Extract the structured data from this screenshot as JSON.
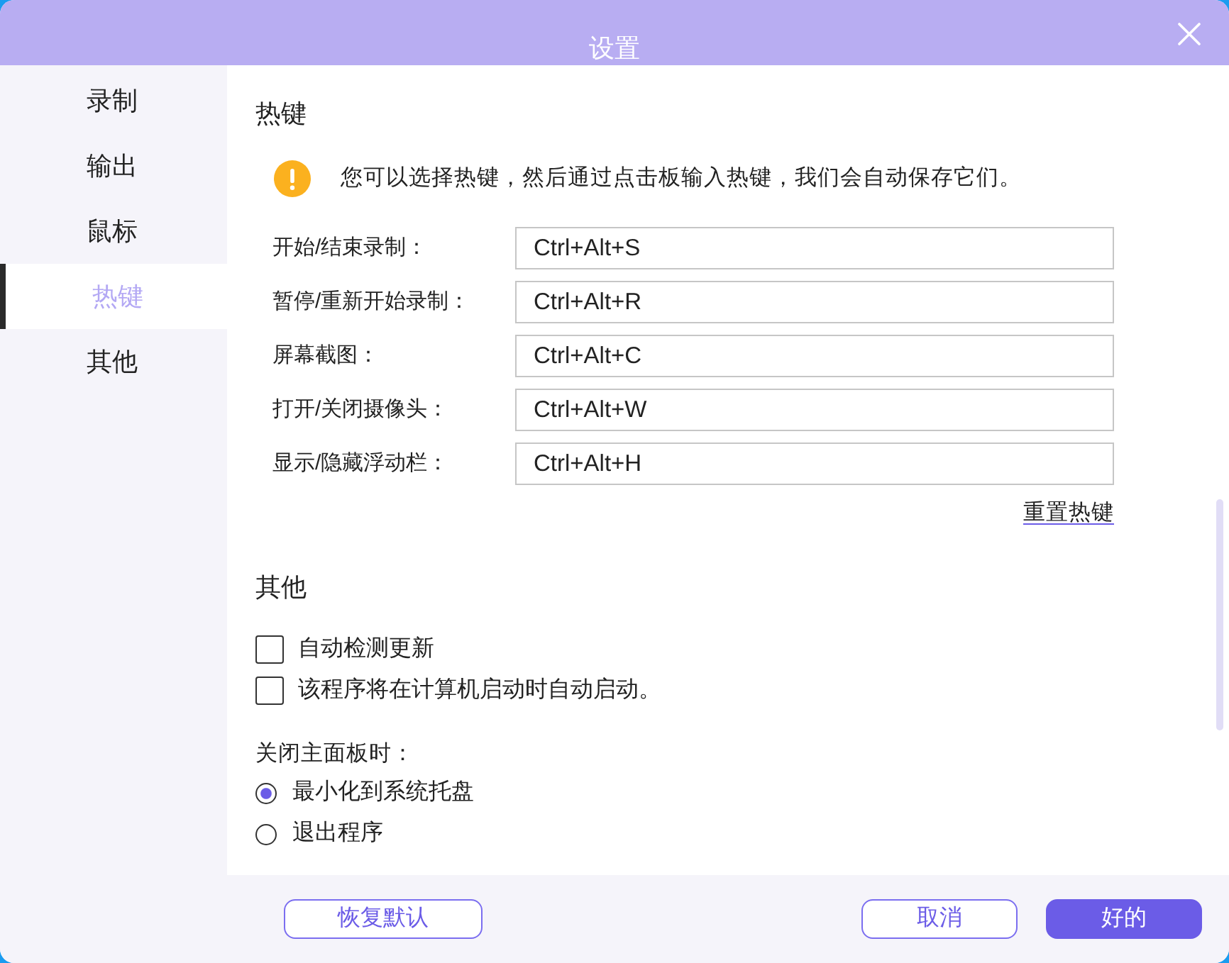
{
  "window": {
    "title": "设置"
  },
  "sidebar": {
    "items": [
      {
        "label": "录制",
        "selected": false
      },
      {
        "label": "输出",
        "selected": false
      },
      {
        "label": "鼠标",
        "selected": false
      },
      {
        "label": "热键",
        "selected": true
      },
      {
        "label": "其他",
        "selected": false
      }
    ]
  },
  "hotkeys": {
    "title": "热键",
    "notice": "您可以选择热键，然后通过点击板输入热键，我们会自动保存它们。",
    "rows": [
      {
        "label": "开始/结束录制：",
        "value": "Ctrl+Alt+S"
      },
      {
        "label": "暂停/重新开始录制：",
        "value": "Ctrl+Alt+R"
      },
      {
        "label": "屏幕截图：",
        "value": "Ctrl+Alt+C"
      },
      {
        "label": "打开/关闭摄像头：",
        "value": "Ctrl+Alt+W"
      },
      {
        "label": "显示/隐藏浮动栏：",
        "value": "Ctrl+Alt+H"
      }
    ],
    "reset_link": "重置热键"
  },
  "other": {
    "title": "其他",
    "checkboxes": [
      {
        "label": "自动检测更新",
        "checked": false
      },
      {
        "label": "该程序将在计算机启动时自动启动。",
        "checked": false
      }
    ],
    "close_behavior": {
      "label": "关闭主面板时：",
      "options": [
        {
          "label": "最小化到系统托盘",
          "selected": true
        },
        {
          "label": "退出程序",
          "selected": false
        }
      ]
    }
  },
  "footer": {
    "left_buttons": [
      {
        "label": "恢复默认",
        "kind": "outline"
      }
    ],
    "right_buttons": [
      {
        "label": "取消",
        "kind": "outline"
      },
      {
        "label": "好的",
        "kind": "primary"
      }
    ]
  }
}
